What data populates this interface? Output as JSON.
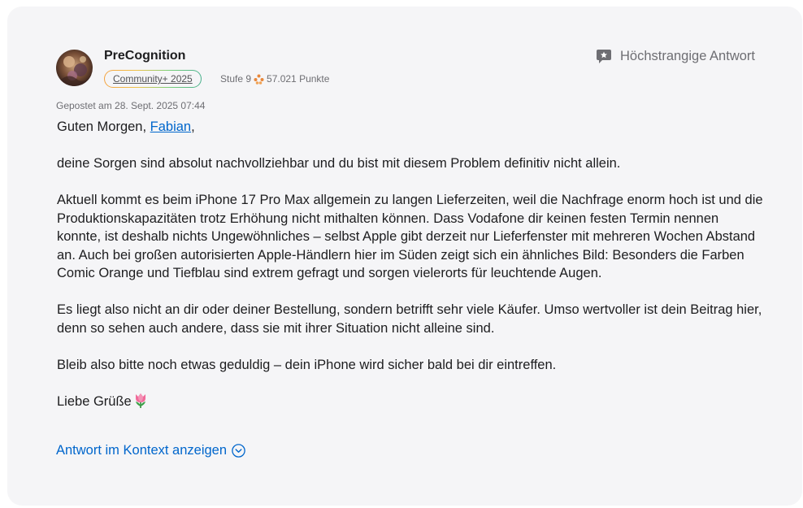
{
  "post": {
    "author": "PreCognition",
    "badge": "Community+ 2025",
    "level": "Stufe 9",
    "points": "57.021 Punkte",
    "top_answer_label": "Höchstrangige Antwort",
    "posted": "Gepostet am 28. Sept. 2025 07:44",
    "greeting_prefix": "Guten Morgen, ",
    "mention": "Fabian",
    "greeting_suffix": ",",
    "paragraphs": [
      "deine Sorgen sind absolut nachvollziehbar und du bist mit diesem Problem definitiv nicht allein.",
      "Aktuell kommt es beim iPhone 17 Pro Max allgemein zu langen Lieferzeiten, weil die Nachfrage enorm hoch ist und die Produktionskapazitäten trotz Erhöhung nicht mithalten können. Dass Vodafone dir keinen festen Termin nennen konnte, ist deshalb nichts Ungewöhnliches – selbst Apple gibt derzeit nur Lieferfenster mit mehreren Wochen Abstand an. Auch bei großen autorisierten Apple-Händlern hier im Süden zeigt sich ein ähnliches Bild: Besonders die Farben Comic Orange und Tiefblau sind extrem gefragt und sorgen vielerorts für leuchtende Augen.",
      "Es liegt also nicht an dir oder deiner Bestellung, sondern betrifft sehr viele Käufer. Umso wertvoller ist dein Beitrag hier, denn so sehen auch andere, dass sie mit ihrer Situation nicht alleine sind.",
      "Bleib also bitte noch etwas geduldig – dein iPhone wird sicher bald bei dir eintreffen."
    ],
    "closing": "Liebe Grüße",
    "context_link": "Antwort im Kontext anzeigen"
  },
  "icons": {
    "top_answer": "star-speech-bubble-icon",
    "points": "community-points-icon",
    "closing_emoji": "tulip-icon",
    "context_chevron": "chevron-down-circle-icon"
  },
  "colors": {
    "card_bg": "#f5f5f7",
    "link": "#0066cc",
    "muted": "#6e6e73",
    "text": "#1d1d1f"
  }
}
